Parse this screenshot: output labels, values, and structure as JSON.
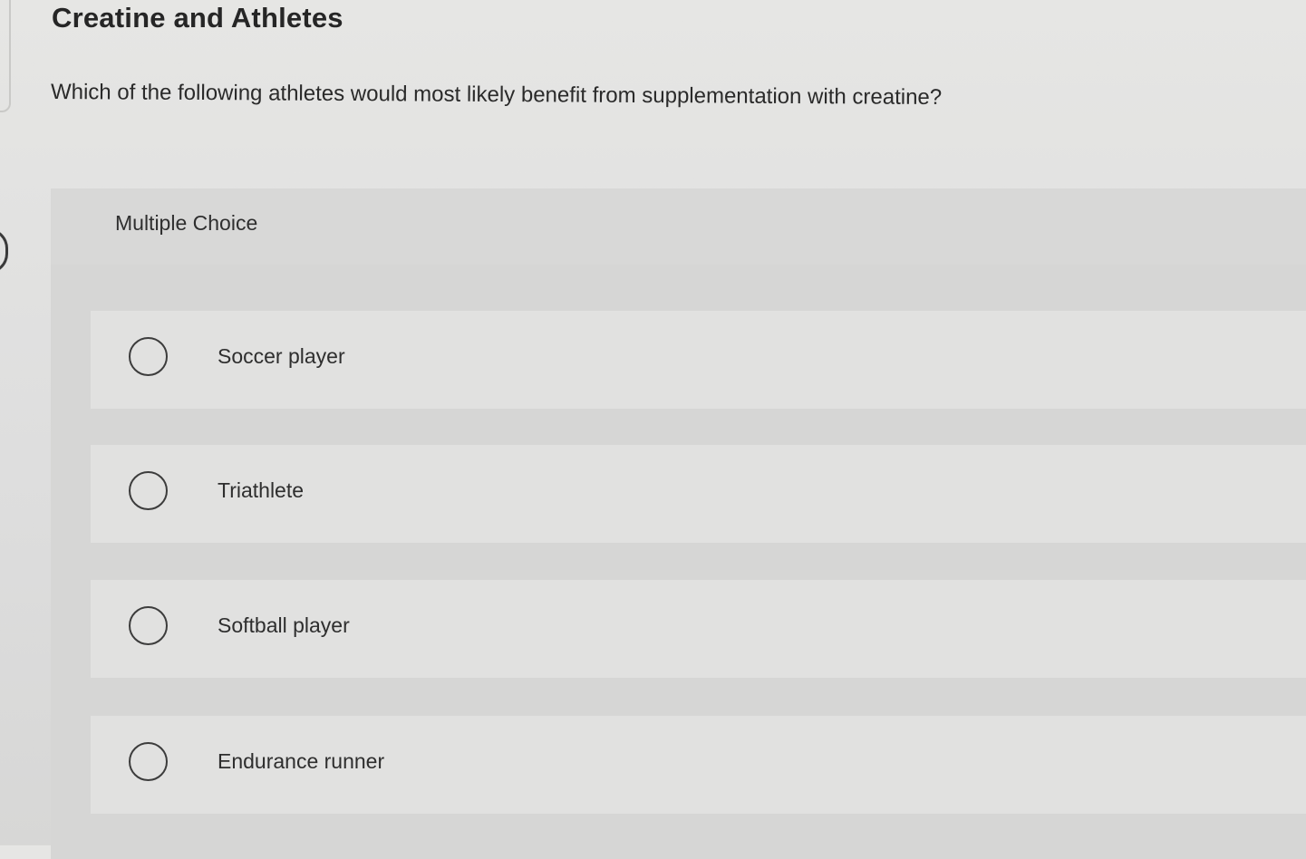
{
  "title": "Creatine and Athletes",
  "question": "Which of the following athletes would most likely benefit from supplementation with creatine?",
  "multiple_choice": {
    "label": "Multiple Choice",
    "options": [
      {
        "label": "Soccer player",
        "selected": false
      },
      {
        "label": "Triathlete",
        "selected": false
      },
      {
        "label": "Softball player",
        "selected": false
      },
      {
        "label": "Endurance runner",
        "selected": false
      }
    ]
  }
}
